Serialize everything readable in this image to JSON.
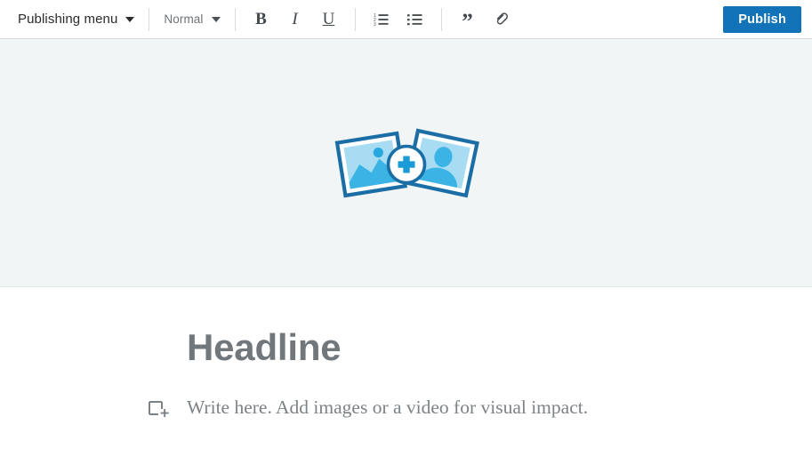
{
  "toolbar": {
    "publishing_menu": {
      "label": "Publishing menu",
      "icon": "chevron-down-icon"
    },
    "text_style": {
      "label": "Normal",
      "icon": "chevron-down-icon",
      "options": [
        "Normal"
      ]
    },
    "format_buttons": [
      {
        "name": "bold",
        "glyph": "B",
        "icon": "bold-icon"
      },
      {
        "name": "italic",
        "glyph": "I",
        "icon": "italic-icon"
      },
      {
        "name": "underline",
        "glyph": "U",
        "icon": "underline-icon"
      }
    ],
    "list_buttons": [
      {
        "name": "ordered-list",
        "icon": "ordered-list-icon"
      },
      {
        "name": "unordered-list",
        "icon": "unordered-list-icon"
      }
    ],
    "insert_buttons": [
      {
        "name": "blockquote",
        "glyph": "”",
        "icon": "quote-icon"
      },
      {
        "name": "link",
        "icon": "link-icon"
      }
    ],
    "publish": {
      "label": "Publish",
      "color": "#1273b8",
      "text_color": "#ffffff"
    }
  },
  "hero": {
    "name": "add-media-placeholder",
    "icon": "add-photos-icon",
    "background": "#f1f5f6",
    "accent": "#1b6ea5",
    "fill": "#a8dcf2",
    "plus_color": "#1a9bd7"
  },
  "article": {
    "headline": {
      "text": "Headline",
      "color": "#72777c"
    },
    "body": {
      "add_block_icon": "add-block-icon",
      "placeholder": "Write here. Add images or a video for visual impact.",
      "color": "#7c8286"
    }
  }
}
